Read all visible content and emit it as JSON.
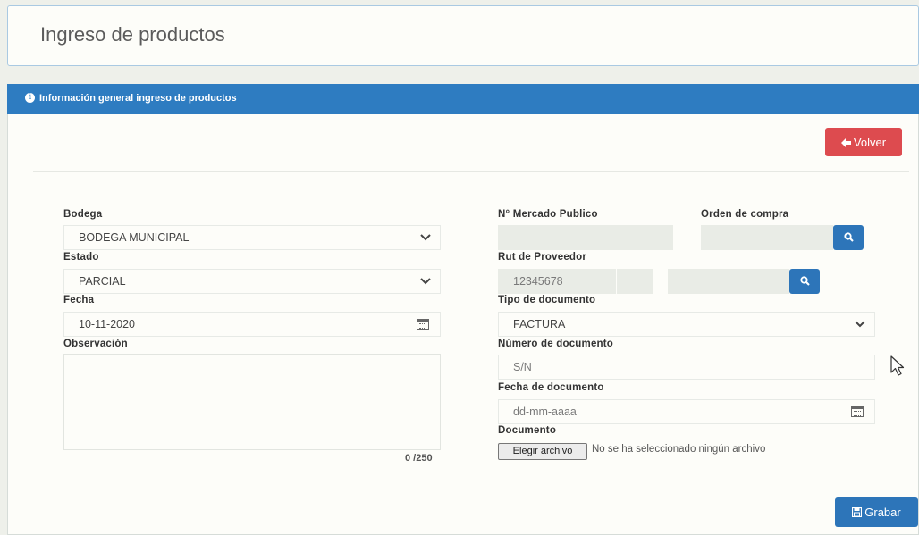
{
  "page": {
    "title": "Ingreso de productos"
  },
  "panel": {
    "header": "Información general ingreso de productos"
  },
  "actions": {
    "back_label": "Volver",
    "save_label": "Grabar"
  },
  "form": {
    "bodega": {
      "label": "Bodega",
      "value": "BODEGA MUNICIPAL"
    },
    "estado": {
      "label": "Estado",
      "value": "PARCIAL"
    },
    "fecha": {
      "label": "Fecha",
      "value": "10-11-2020"
    },
    "observacion": {
      "label": "Observación",
      "counter": "0 /250"
    },
    "mercado_publico": {
      "label": "N° Mercado Publico",
      "value": ""
    },
    "orden_compra": {
      "label": "Orden de compra",
      "value": ""
    },
    "rut_proveedor": {
      "label": "Rut de Proveedor",
      "placeholder": "12345678",
      "dv": "",
      "name": ""
    },
    "tipo_documento": {
      "label": "Tipo de documento",
      "value": "FACTURA"
    },
    "numero_documento": {
      "label": "Número de documento",
      "placeholder": "S/N"
    },
    "fecha_documento": {
      "label": "Fecha de documento",
      "placeholder": "dd-mm-aaaa"
    },
    "documento": {
      "label": "Documento",
      "button": "Elegir archivo",
      "status": "No se ha seleccionado ningún archivo"
    }
  },
  "icons": {
    "info": "info-icon",
    "back": "arrow-left-icon",
    "search": "search-icon",
    "chevron": "chevron-down-icon",
    "calendar": "calendar-icon",
    "save": "floppy-disk-icon"
  },
  "colors": {
    "primary": "#2e7cc1",
    "danger": "#dd4b4f",
    "background": "#eef0ea",
    "card": "#fdfdf9"
  }
}
